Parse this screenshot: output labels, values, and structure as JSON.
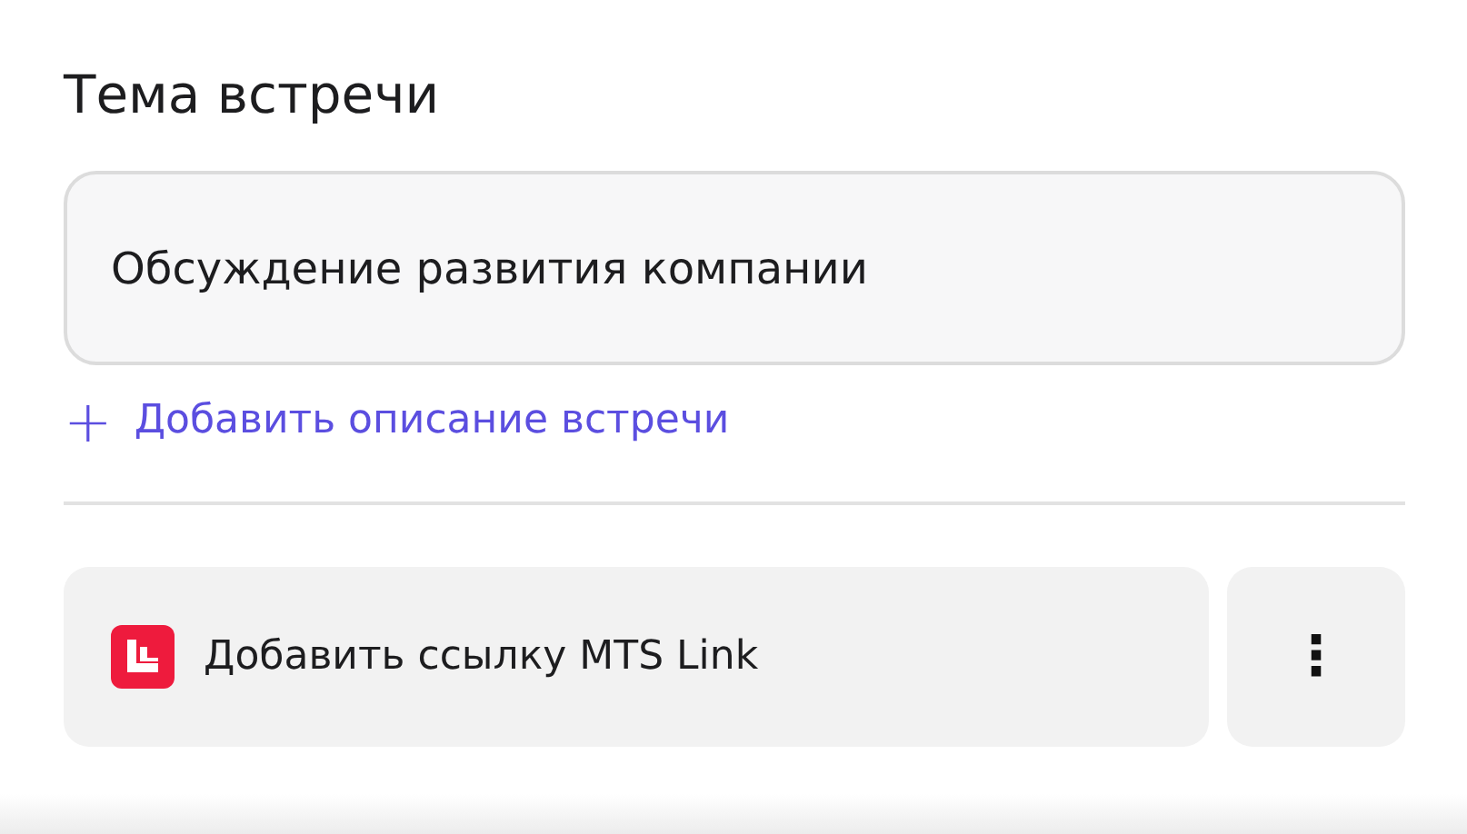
{
  "heading": "Тема встречи",
  "topic_field": {
    "value": "Обсуждение развития компании"
  },
  "add_description": {
    "icon": "+",
    "label": "Добавить описание встречи"
  },
  "link_button": {
    "label": "Добавить ссылку MTS Link"
  },
  "more_button": {
    "icon": "⋮"
  }
}
